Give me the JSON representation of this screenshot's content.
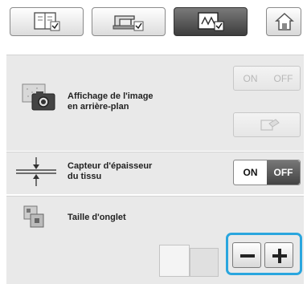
{
  "tabs": [
    {
      "icon": "book-settings-icon",
      "active": false
    },
    {
      "icon": "sewing-machine-settings-icon",
      "active": false
    },
    {
      "icon": "embroidery-frame-settings-icon",
      "active": true
    }
  ],
  "home": {
    "icon": "home-icon"
  },
  "settings": {
    "background_image": {
      "label": "Affichage de l'image\nen arrière-plan",
      "on": "ON",
      "off": "OFF",
      "enabled": false,
      "edit_icon": "eraser-icon"
    },
    "fabric_sensor": {
      "label": "Capteur d'épaisseur\ndu tissu",
      "on": "ON",
      "off": "OFF",
      "state": "ON"
    },
    "tab_size": {
      "label": "Taille d'onglet",
      "minus": "−",
      "plus": "+"
    }
  },
  "colors": {
    "highlight": "#2aa6de",
    "panel": "#e9e9e9"
  }
}
